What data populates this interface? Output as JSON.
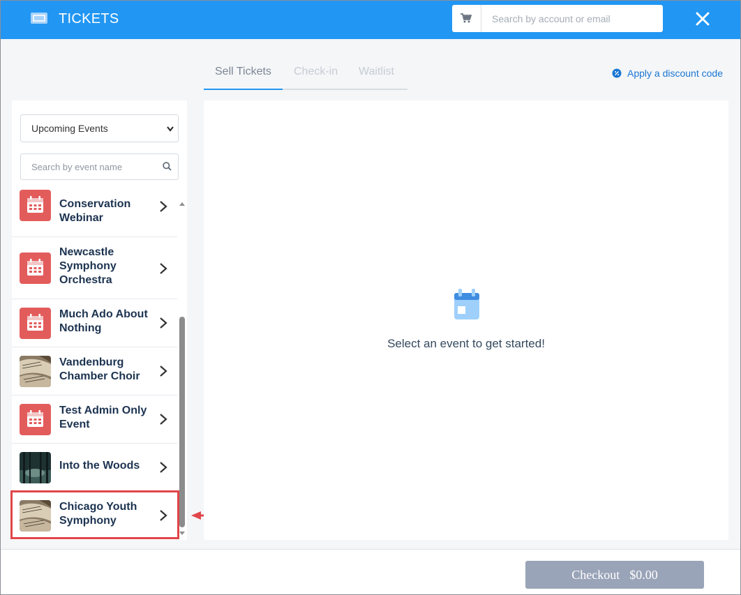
{
  "header": {
    "title": "TICKETS",
    "account_search_placeholder": "Search by account or email",
    "brand_color": "#2196f3"
  },
  "tabs": [
    {
      "label": "Sell Tickets",
      "active": true
    },
    {
      "label": "Check-in",
      "active": false
    },
    {
      "label": "Waitlist",
      "active": false
    }
  ],
  "discount": {
    "label": "Apply a discount code"
  },
  "sidebar": {
    "filter_selected": "Upcoming Events",
    "event_search_placeholder": "Search by event name",
    "events": [
      {
        "name": "Conservation Webinar",
        "thumb": "calendar-icon"
      },
      {
        "name": "Newcastle Symphony Orchestra",
        "thumb": "calendar-icon"
      },
      {
        "name": "Much Ado About Nothing",
        "thumb": "calendar-icon"
      },
      {
        "name": "Vandenburg Chamber Choir",
        "thumb": "sheet-music-photo"
      },
      {
        "name": "Test Admin Only Event",
        "thumb": "calendar-icon"
      },
      {
        "name": "Into the Woods",
        "thumb": "forest-photo"
      },
      {
        "name": "Chicago Youth Symphony",
        "thumb": "sheet-music-photo",
        "highlighted": true
      }
    ]
  },
  "main": {
    "empty_message": "Select an event to get started!"
  },
  "footer": {
    "checkout_label": "Checkout",
    "checkout_amount": "$0.00"
  }
}
